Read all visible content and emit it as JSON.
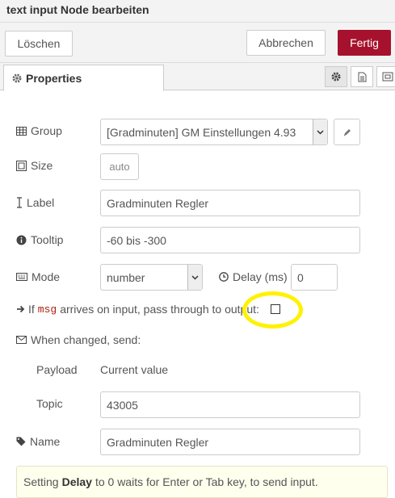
{
  "window": {
    "title": "text input Node bearbeiten"
  },
  "toolbar": {
    "delete_label": "Löschen",
    "cancel_label": "Abbrechen",
    "done_label": "Fertig"
  },
  "tabs": [
    {
      "label": "Properties",
      "icon": "gear-icon"
    }
  ],
  "tab_icons": [
    "gear-icon",
    "document-icon",
    "frame-icon"
  ],
  "form": {
    "group": {
      "label": "Group",
      "icon": "table-icon",
      "value": "[Gradminuten] GM Einstellungen 4.93"
    },
    "size": {
      "label": "Size",
      "icon": "resize-icon",
      "value": "auto"
    },
    "label": {
      "label": "Label",
      "icon": "text-cursor-icon",
      "value": "Gradminuten Regler"
    },
    "tooltip": {
      "label": "Tooltip",
      "icon": "info-icon",
      "value": "-60 bis -300"
    },
    "mode": {
      "label": "Mode",
      "icon": "keyboard-icon",
      "value": "number"
    },
    "delay": {
      "label": "Delay (ms)",
      "icon": "clock-icon",
      "value": "0"
    },
    "passthrough": {
      "prefix": "If",
      "code": "msg",
      "suffix": "arrives on input, pass through to output:",
      "checked": false
    },
    "when_changed": {
      "label": "When changed, send:",
      "icon": "envelope-icon"
    },
    "payload": {
      "label": "Payload",
      "value": "Current value"
    },
    "topic": {
      "label": "Topic",
      "value": "43005"
    },
    "name": {
      "label": "Name",
      "icon": "tag-icon",
      "value": "Gradminuten Regler"
    }
  },
  "tip": {
    "prefix": "Setting",
    "bold": "Delay",
    "suffix": "to 0 waits for Enter or Tab key, to send input."
  },
  "colors": {
    "primary": "#a6122d",
    "highlight": "#fff200",
    "tip_bg": "#ffffee"
  }
}
